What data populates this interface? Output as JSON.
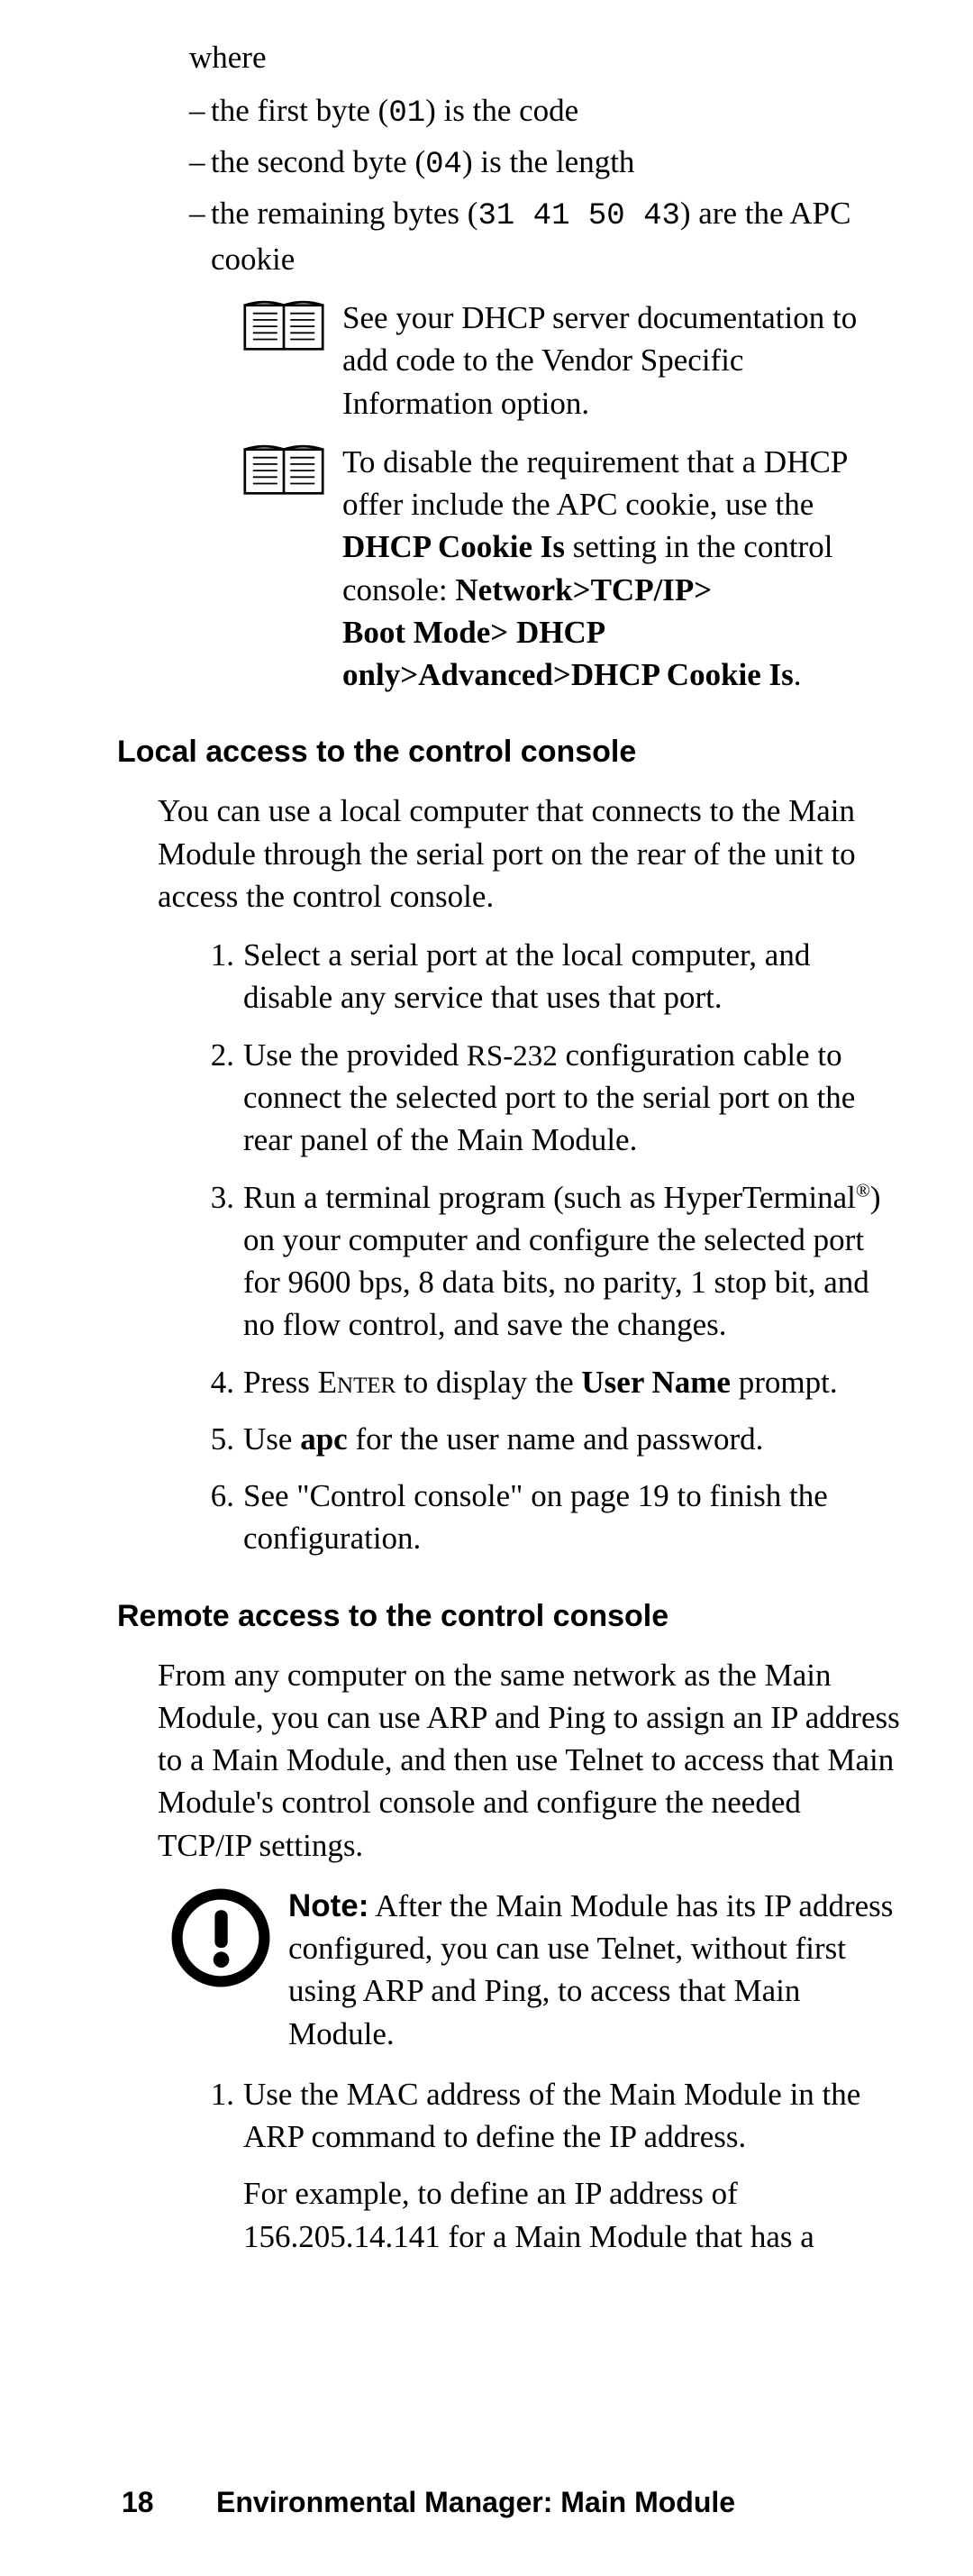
{
  "intro": {
    "where": "where",
    "b1_a": "the first byte (",
    "b1_code": "01",
    "b1_b": ") is the code",
    "b2_a": "the second byte (",
    "b2_code": "04",
    "b2_b": ") is the length",
    "b3_a": "the remaining bytes (",
    "b3_code": "31 41 50 43",
    "b3_b": ") are the APC cookie"
  },
  "info1": "See your DHCP server documentation to add code to the Vendor Specific Information option.",
  "info2": {
    "t1": "To disable the requirement that a DHCP offer include the APC cookie, use the ",
    "b1": "DHCP Cookie Is",
    "t2": " setting in the control console: ",
    "b2": "Network>TCP/IP>",
    "b3": "Boot Mode> DHCP only>Advanced>DHCP Cookie Is",
    "t3": "."
  },
  "sec1": {
    "title": "Local access to the control console",
    "para": "You can use a local computer that connects to the Main Module through the serial port on the rear of the unit to access the control console.",
    "s1": "Select a serial port at the local computer, and disable any service that uses that port.",
    "s2a": "Use the provided ",
    "s2rs": "RS-232",
    "s2b": " configuration cable to connect the selected port to the serial port on the rear panel of the Main Module.",
    "s3a": "Run a terminal program (such as HyperTerminal",
    "s3sup": "®",
    "s3b": ") on your computer and configure the selected port for 9600 bps, 8 data bits, no parity, 1 stop bit, and no flow control, and save the changes.",
    "s4a": "Press ",
    "s4enter": "Enter",
    "s4b": " to display the ",
    "s4bold": "User Name",
    "s4c": " prompt.",
    "s5a": "Use ",
    "s5bold": "apc",
    "s5b": " for the user name and password.",
    "s6": "See \"Control console\" on page 19 to finish the configuration."
  },
  "sec2": {
    "title": "Remote access to the control console",
    "para": "From any computer on the same network as the Main Module, you can use ARP and Ping to assign an IP address to a Main Module, and then use Telnet to access that Main Module's control console and configure the needed TCP/IP settings.",
    "note_label": "Note:",
    "note_text": " After the Main Module has its IP address configured, you can use Telnet, without first using ARP and Ping, to access that Main Module.",
    "s1": "Use the MAC address of the Main Module in the ARP command to define the IP address.",
    "s1b": "For example, to define an IP address of 156.205.14.141 for a Main Module that has a"
  },
  "footer": {
    "page": "18",
    "title": "Environmental Manager: Main Module"
  }
}
